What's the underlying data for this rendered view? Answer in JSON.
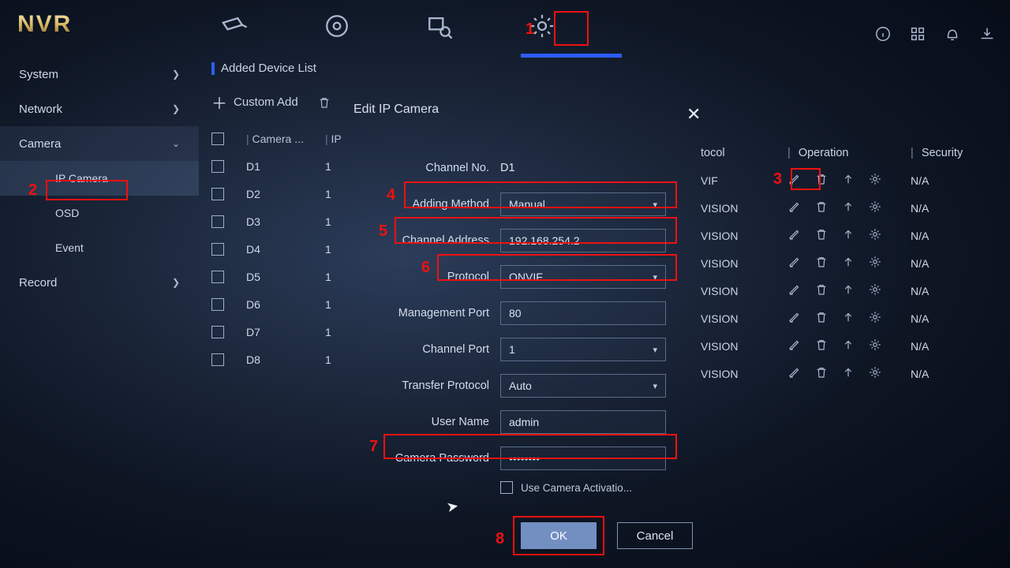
{
  "brand": "NVR",
  "topnav_icons": [
    "camera-icon",
    "playback-icon",
    "search-icon",
    "settings-icon"
  ],
  "right_icons": [
    "info-icon",
    "grid-icon",
    "bell-icon",
    "export-icon"
  ],
  "sidebar": {
    "items": [
      {
        "label": "System",
        "expandable": true
      },
      {
        "label": "Network",
        "expandable": true
      },
      {
        "label": "Camera",
        "expandable": true,
        "expanded": true,
        "children": [
          {
            "label": "IP Camera",
            "active": true
          },
          {
            "label": "OSD"
          },
          {
            "label": "Event"
          }
        ]
      },
      {
        "label": "Record",
        "expandable": true
      }
    ]
  },
  "section_header": "Added Device List",
  "toolbar": {
    "custom_add": "Custom Add",
    "edit": "Edit IP Camera"
  },
  "table": {
    "headers": {
      "camera": "Camera ...",
      "ip": "IP",
      "protocol": "tocol",
      "operation": "Operation",
      "security": "Security"
    },
    "rows": [
      {
        "ch": "D1",
        "ip": "1",
        "protocol": "VIF",
        "security": "N/A"
      },
      {
        "ch": "D2",
        "ip": "1",
        "protocol": "VISION",
        "security": "N/A"
      },
      {
        "ch": "D3",
        "ip": "1",
        "protocol": "VISION",
        "security": "N/A"
      },
      {
        "ch": "D4",
        "ip": "1",
        "protocol": "VISION",
        "security": "N/A"
      },
      {
        "ch": "D5",
        "ip": "1",
        "protocol": "VISION",
        "security": "N/A"
      },
      {
        "ch": "D6",
        "ip": "1",
        "protocol": "VISION",
        "security": "N/A"
      },
      {
        "ch": "D7",
        "ip": "1",
        "protocol": "VISION",
        "security": "N/A"
      },
      {
        "ch": "D8",
        "ip": "1",
        "protocol": "VISION",
        "security": "N/A"
      }
    ]
  },
  "dialog": {
    "title": "Edit IP Camera",
    "channel_no_label": "Channel No.",
    "channel_no_value": "D1",
    "adding_method_label": "Adding Method",
    "adding_method_value": "Manual",
    "channel_address_label": "Channel Address",
    "channel_address_value": "192.168.254.2",
    "protocol_label": "Protocol",
    "protocol_value": "ONVIF",
    "mgmt_port_label": "Management Port",
    "mgmt_port_value": "80",
    "channel_port_label": "Channel Port",
    "channel_port_value": "1",
    "transfer_protocol_label": "Transfer Protocol",
    "transfer_protocol_value": "Auto",
    "user_name_label": "User Name",
    "user_name_value": "admin",
    "camera_password_label": "Camera Password",
    "camera_password_value": "••••••••",
    "use_activation_label": "Use Camera Activatio...",
    "ok": "OK",
    "cancel": "Cancel"
  },
  "annotations": {
    "1": "1",
    "2": "2",
    "3": "3",
    "4": "4",
    "5": "5",
    "6": "6",
    "7": "7",
    "8": "8"
  }
}
